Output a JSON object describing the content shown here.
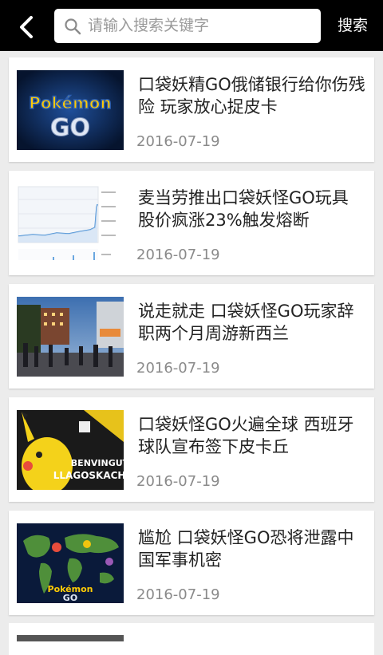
{
  "header": {
    "search_placeholder": "请输入搜索关键字",
    "search_button_label": "搜索"
  },
  "articles": [
    {
      "title": "口袋妖精GO俄储银行给你伤残险 玩家放心捉皮卡",
      "date": "2016-07-19",
      "thumb_text": [
        "Pokémon",
        "GO"
      ]
    },
    {
      "title": "麦当劳推出口袋妖怪GO玩具 股价疯涨23%触发熔断",
      "date": "2016-07-19"
    },
    {
      "title": "说走就走 口袋妖怪GO玩家辞职两个月周游新西兰",
      "date": "2016-07-19"
    },
    {
      "title": "口袋妖怪GO火遍全球 西班牙球队宣布签下皮卡丘",
      "date": "2016-07-19",
      "thumb_text": [
        "BENVINGUT",
        "LLAGOSKACHU"
      ]
    },
    {
      "title": "尴尬 口袋妖怪GO恐将泄露中国军事机密",
      "date": "2016-07-19",
      "thumb_text": [
        "Pokémon",
        "GO"
      ]
    }
  ],
  "colors": {
    "topbar": "#000000",
    "background": "#ececec",
    "date": "#8a8a8a"
  },
  "icons": {
    "back": "back-arrow-icon",
    "search": "search-icon"
  }
}
